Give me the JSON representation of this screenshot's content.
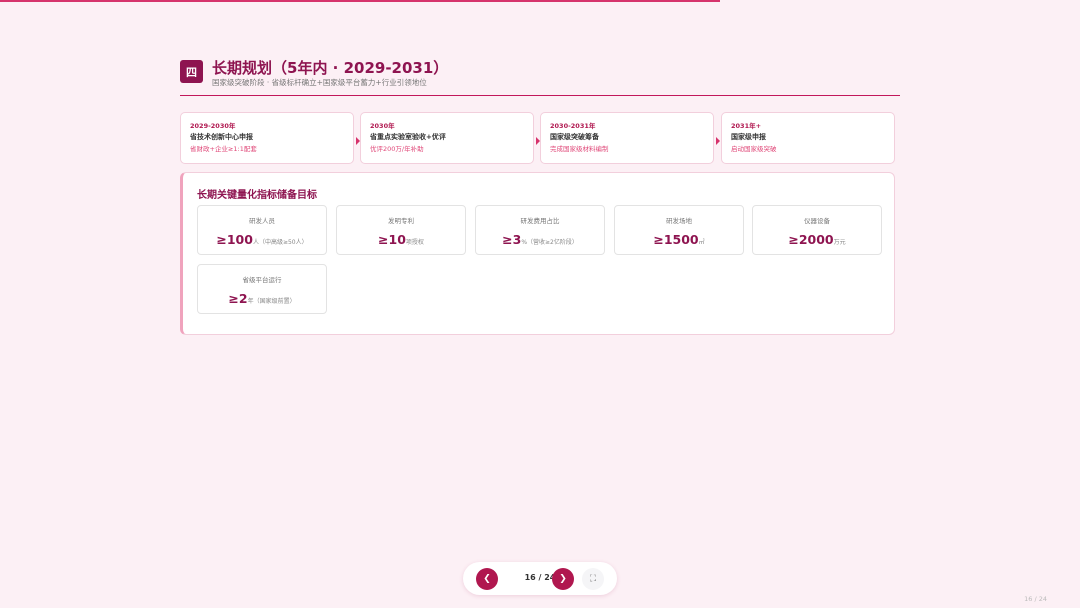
{
  "progress": {
    "fraction": 0.667
  },
  "header": {
    "badge": "四",
    "title": "长期规划（5年内 · 2029-2031）",
    "subtitle": "国家级突破阶段 · 省级标杆确立+国家级平台蓄力+行业引领地位"
  },
  "timeline": [
    {
      "period": "2029-2030年",
      "name": "省技术创新中心申报",
      "note": "省财政+企业≥1:1配套"
    },
    {
      "period": "2030年",
      "name": "省重点实验室验收+优评",
      "note": "优评200万/年补助"
    },
    {
      "period": "2030-2031年",
      "name": "国家级突破筹备",
      "note": "完成国家级材料编制"
    },
    {
      "period": "2031年+",
      "name": "国家级申报",
      "note": "启动国家级突破"
    }
  ],
  "metrics_panel": {
    "title": "长期关键量化指标储备目标",
    "items": [
      {
        "label": "研发人员",
        "value": "≥100",
        "unit": "人（中高级≥50人）"
      },
      {
        "label": "发明专利",
        "value": "≥10",
        "unit": "项授权"
      },
      {
        "label": "研发费用占比",
        "value": "≥3",
        "unit": "%（营收≥2亿阶段）"
      },
      {
        "label": "研发场地",
        "value": "≥1500",
        "unit": "㎡"
      },
      {
        "label": "仪器设备",
        "value": "≥2000",
        "unit": "万元"
      },
      {
        "label": "省级平台运行",
        "value": "≥2",
        "unit": "年（国家级前置）"
      }
    ]
  },
  "pager": {
    "prev_icon": "chevron-left-icon",
    "prev_glyph": "❮",
    "count": "16 / 24",
    "next_icon": "chevron-right-icon",
    "next_glyph": "❯",
    "fullscreen_icon": "fullscreen-icon",
    "fullscreen_glyph": "⛶"
  },
  "corner_count": "16 / 24",
  "colors": {
    "accent": "#8e1450",
    "highlight": "#d6336c",
    "background": "#fcf0f5"
  }
}
